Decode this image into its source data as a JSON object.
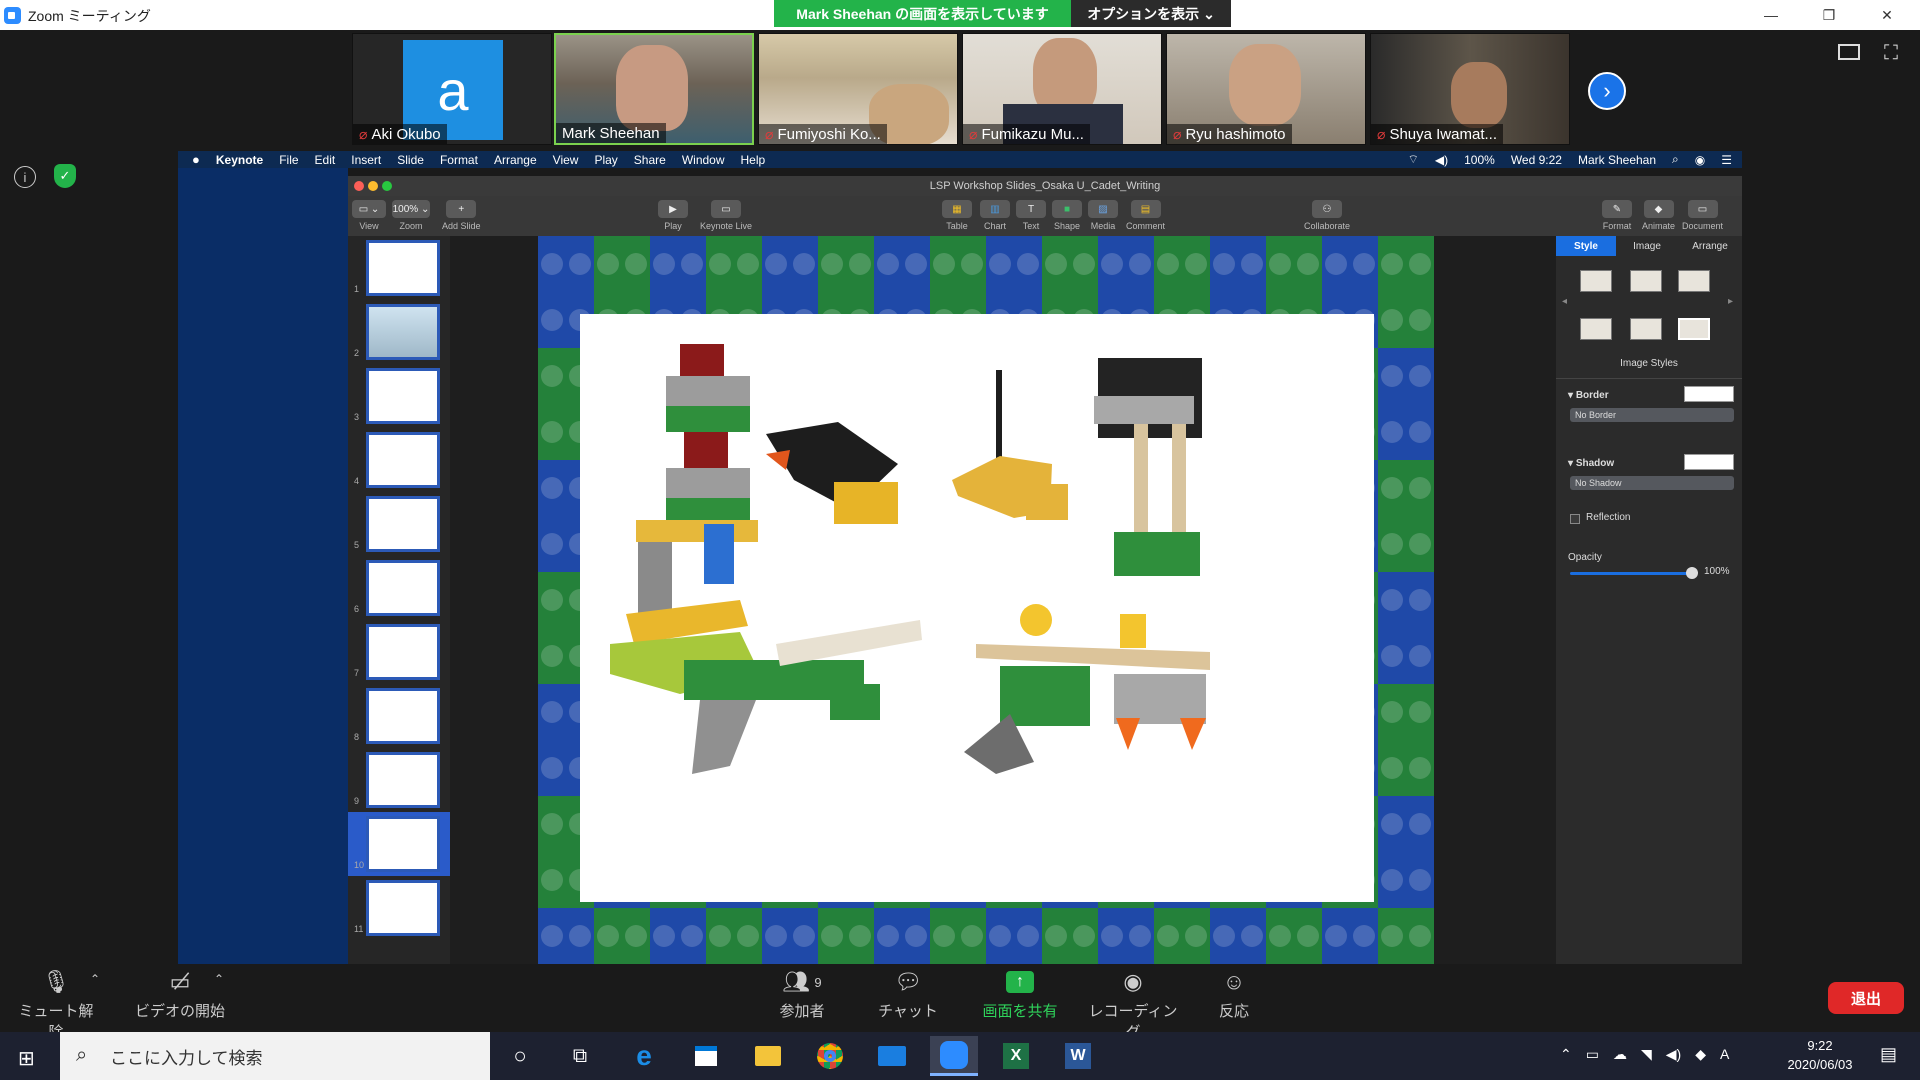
{
  "window": {
    "title": "Zoom ミーティング"
  },
  "share_banner": {
    "text": "Mark  Sheehan の画面を表示しています",
    "options": "オプションを表示 ⌄"
  },
  "participants": [
    {
      "name": "Aki Okubo",
      "avatar_letter": "a"
    },
    {
      "name": "Mark Sheehan"
    },
    {
      "name": "Fumiyoshi Ko..."
    },
    {
      "name": "Fumikazu Mu..."
    },
    {
      "name": "Ryu hashimoto"
    },
    {
      "name": "Shuya Iwamat..."
    }
  ],
  "mac_menu": {
    "items": [
      "Keynote",
      "File",
      "Edit",
      "Insert",
      "Slide",
      "Format",
      "Arrange",
      "View",
      "Play",
      "Share",
      "Window",
      "Help"
    ],
    "battery": "100%",
    "clock": "Wed 9:22",
    "user": "Mark Sheehan"
  },
  "keynote": {
    "doc_title": "LSP Workshop Slides_Osaka U_Cadet_Writing",
    "toolbar_left": [
      {
        "label": "View",
        "btn": "▭ ⌄"
      },
      {
        "label": "Zoom",
        "btn": "100% ⌄"
      },
      {
        "label": "Add Slide",
        "btn": "+"
      }
    ],
    "toolbar_mid": [
      {
        "label": "Play",
        "btn": "▶"
      },
      {
        "label": "Keynote Live",
        "btn": "▭"
      }
    ],
    "toolbar_insert": [
      {
        "label": "Table",
        "btn": "▦"
      },
      {
        "label": "Chart",
        "btn": "▥"
      },
      {
        "label": "Text",
        "btn": "T"
      },
      {
        "label": "Shape",
        "btn": "■"
      },
      {
        "label": "Media",
        "btn": "▨"
      },
      {
        "label": "Comment",
        "btn": "▤"
      }
    ],
    "toolbar_collab": {
      "label": "Collaborate",
      "btn": "⚇"
    },
    "toolbar_right": [
      {
        "label": "Format",
        "btn": "✎"
      },
      {
        "label": "Animate",
        "btn": "◆"
      },
      {
        "label": "Document",
        "btn": "▭"
      }
    ],
    "slide_numbers": [
      "1",
      "2",
      "3",
      "4",
      "5",
      "6",
      "7",
      "8",
      "9",
      "10",
      "11"
    ],
    "inspector": {
      "tabs": [
        "Style",
        "Image",
        "Arrange"
      ],
      "image_styles_label": "Image Styles",
      "border_label": "Border",
      "border_value": "No Border",
      "shadow_label": "Shadow",
      "shadow_value": "No Shadow",
      "reflection_label": "Reflection",
      "opacity_label": "Opacity",
      "opacity_value": "100%"
    }
  },
  "zoom_bar": {
    "mute": "ミュート解除",
    "video": "ビデオの開始",
    "participants": "参加者",
    "participants_count": "9",
    "chat": "チャット",
    "share": "画面を共有",
    "record": "レコーディング",
    "reactions": "反応",
    "exit": "退出"
  },
  "taskbar": {
    "search_placeholder": "ここに入力して検索",
    "time": "9:22",
    "date": "2020/06/03",
    "ime": "A"
  },
  "colors": {
    "accent": "#2d8cff",
    "share_green": "#23b34a",
    "exit_red": "#e02828"
  }
}
